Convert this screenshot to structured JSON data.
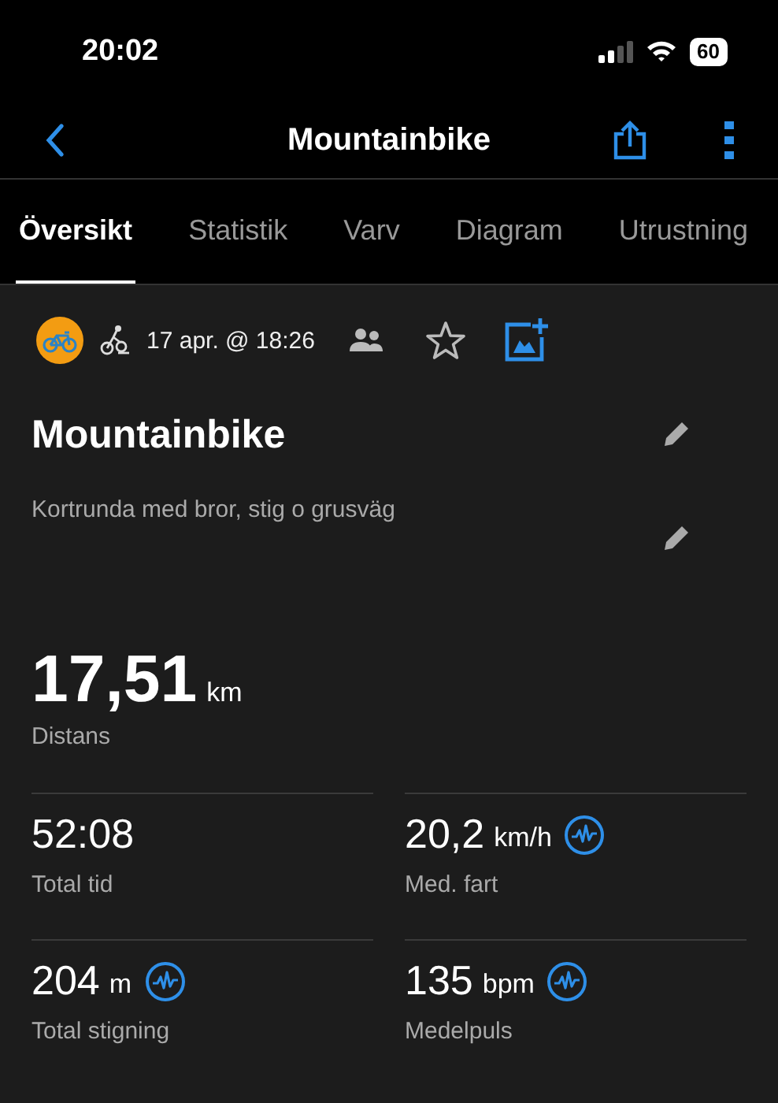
{
  "status_bar": {
    "time": "20:02",
    "battery": "60"
  },
  "nav": {
    "title": "Mountainbike"
  },
  "tabs": [
    {
      "label": "Översikt",
      "selected": true
    },
    {
      "label": "Statistik",
      "selected": false
    },
    {
      "label": "Varv",
      "selected": false
    },
    {
      "label": "Diagram",
      "selected": false
    },
    {
      "label": "Utrustning",
      "selected": false
    }
  ],
  "activity": {
    "date": "17 apr. @ 18:26",
    "favorite": false,
    "title": "Mountainbike",
    "description": "Kortrunda med bror, stig o grusväg"
  },
  "distance": {
    "value": "17,51",
    "unit": "km",
    "label": "Distans"
  },
  "stats": [
    {
      "value": "52:08",
      "label": "Total tid",
      "graph": false
    },
    {
      "value": "20,2",
      "unit": "km/h",
      "label": "Med. fart",
      "graph": true
    },
    {
      "value": "204",
      "unit": "m",
      "label": "Total stigning",
      "graph": true
    },
    {
      "value": "135",
      "unit": "bpm",
      "label": "Medelpuls",
      "graph": true
    }
  ]
}
